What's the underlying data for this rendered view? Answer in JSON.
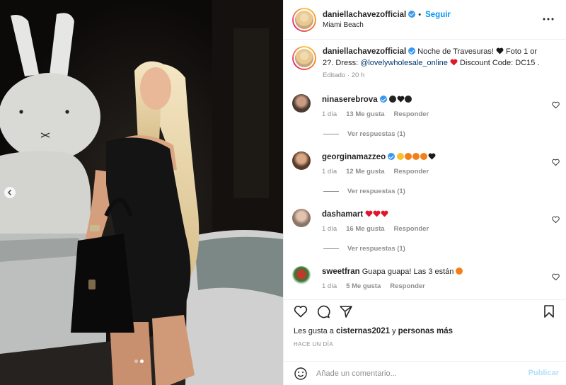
{
  "post": {
    "username": "daniellachavezofficial",
    "follow_label": "Seguir",
    "separator": "•",
    "location": "Miami Beach",
    "more_icon": "more-horizontal-icon"
  },
  "photo": {
    "prev_icon": "chevron-left-icon",
    "slide_count": 2,
    "active_slide": 2
  },
  "caption": {
    "username": "daniellachavezofficial",
    "text_1": " Noche de Travesuras! ",
    "text_2": " Foto 1 or 2?. Dress: ",
    "mention": "@lovelywholesale_online",
    "text_3": " Discount Code: DC15 .",
    "edited": "Editado",
    "time": "20 h"
  },
  "comments": [
    {
      "username": "ninaserebrova",
      "text": "",
      "emojis": [
        "bomb",
        "black-heart",
        "bomb"
      ],
      "age": "1 día",
      "likes": "13 Me gusta",
      "reply": "Responder",
      "view_replies": "Ver respuestas (1)",
      "verified": true
    },
    {
      "username": "georginamazzeo",
      "text": "",
      "emojis": [
        "heart-eyes",
        "fire",
        "fire",
        "fire",
        "black-heart"
      ],
      "age": "1 día",
      "likes": "12 Me gusta",
      "reply": "Responder",
      "view_replies": "Ver respuestas (1)",
      "verified": true
    },
    {
      "username": "dashamart",
      "text": "",
      "emojis": [
        "red-heart",
        "red-heart",
        "red-heart"
      ],
      "age": "1 día",
      "likes": "16 Me gusta",
      "reply": "Responder",
      "view_replies": "Ver respuestas (1)",
      "verified": false
    },
    {
      "username": "sweetfran",
      "text": "Guapa guapa! Las 3 están ",
      "emojis": [
        "fire"
      ],
      "age": "1 día",
      "likes": "5 Me gusta",
      "reply": "Responder",
      "view_replies": "",
      "verified": false
    }
  ],
  "actions": {
    "like_icon": "heart-icon",
    "comment_icon": "comment-icon",
    "share_icon": "send-icon",
    "save_icon": "bookmark-icon",
    "likes_prefix": "Les gusta a ",
    "likes_user": "cisternas2021",
    "likes_mid": " y ",
    "likes_others": "personas más",
    "time_ago": "HACE UN DÍA"
  },
  "composer": {
    "emoji_icon": "smiley-icon",
    "placeholder": "Añade un comentario...",
    "publish_label": "Publicar"
  },
  "colors": {
    "accent": "#0095f6",
    "link": "#00376b",
    "muted": "#8e8e8e",
    "publish_disabled": "#b2dffc",
    "red_heart": "#e0162b"
  }
}
